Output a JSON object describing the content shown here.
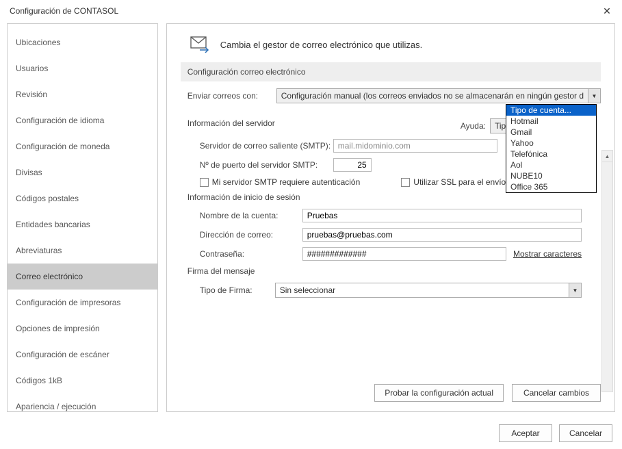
{
  "window": {
    "title": "Configuración de CONTASOL"
  },
  "sidebar": {
    "items": [
      {
        "label": "Ubicaciones"
      },
      {
        "label": "Usuarios"
      },
      {
        "label": "Revisión"
      },
      {
        "label": "Configuración de idioma"
      },
      {
        "label": "Configuración de moneda"
      },
      {
        "label": "Divisas"
      },
      {
        "label": "Códigos postales"
      },
      {
        "label": "Entidades bancarias"
      },
      {
        "label": "Abreviaturas"
      },
      {
        "label": "Correo electrónico",
        "selected": true
      },
      {
        "label": "Configuración de impresoras"
      },
      {
        "label": "Opciones de impresión"
      },
      {
        "label": "Configuración de escáner"
      },
      {
        "label": "Códigos 1kB"
      },
      {
        "label": "Apariencia / ejecución"
      }
    ]
  },
  "header": {
    "text": "Cambia el gestor de correo electrónico que utilizas."
  },
  "section1": {
    "title": "Configuración correo electrónico",
    "send_label": "Enviar correos con:",
    "send_value": "Configuración manual (los correos enviados no se almacenarán en ningún gestor d"
  },
  "server": {
    "heading": "Información del servidor",
    "help_label": "Ayuda:",
    "help_value": "Tipo de cuenta...",
    "help_options": [
      "Tipo de cuenta...",
      "Hotmail",
      "Gmail",
      "Yahoo",
      "Telefónica",
      "Aol",
      "NUBE10",
      "Office 365"
    ],
    "smtp_label": "Servidor de correo saliente (SMTP):",
    "smtp_value": "mail.midominio.com",
    "port_label": "Nº de puerto del servidor SMTP:",
    "port_value": "25",
    "auth_label": "Mi servidor SMTP requiere autenticación",
    "ssl_label": "Utilizar SSL para el envío de"
  },
  "session": {
    "heading": "Información de inicio de sesión",
    "acct_label": "Nombre de la cuenta:",
    "acct_value": "Pruebas",
    "mail_label": "Dirección de correo:",
    "mail_value": "pruebas@pruebas.com",
    "pass_label": "Contraseña:",
    "pass_value": "#############",
    "show_chars": "Mostrar caracteres"
  },
  "signature": {
    "heading": "Firma del mensaje",
    "type_label": "Tipo de Firma:",
    "type_value": "Sin seleccionar"
  },
  "panel_buttons": {
    "test": "Probar la configuración actual",
    "cancel_changes": "Cancelar cambios"
  },
  "dialog_buttons": {
    "ok": "Aceptar",
    "cancel": "Cancelar"
  }
}
